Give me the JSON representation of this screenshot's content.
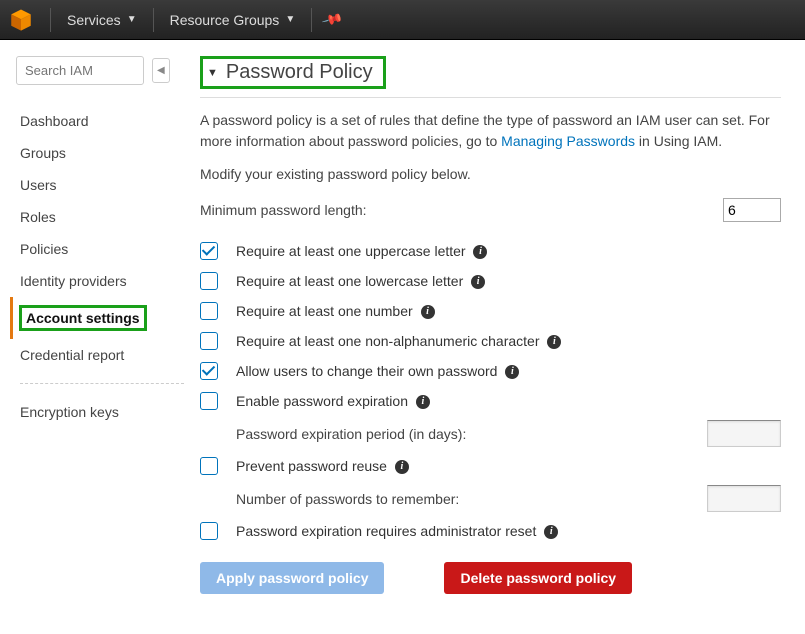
{
  "topnav": {
    "services": "Services",
    "resource_groups": "Resource Groups"
  },
  "sidebar": {
    "search_placeholder": "Search IAM",
    "items": [
      {
        "label": "Dashboard"
      },
      {
        "label": "Groups"
      },
      {
        "label": "Users"
      },
      {
        "label": "Roles"
      },
      {
        "label": "Policies"
      },
      {
        "label": "Identity providers"
      },
      {
        "label": "Account settings"
      },
      {
        "label": "Credential report"
      }
    ],
    "items2": [
      {
        "label": "Encryption keys"
      }
    ]
  },
  "main": {
    "title": "Password Policy",
    "desc_pre": "A password policy is a set of rules that define the type of password an IAM user can set. For more information about password policies, go to ",
    "desc_link": "Managing Passwords",
    "desc_post": " in Using IAM.",
    "subhead": "Modify your existing password policy below.",
    "minlen_label": "Minimum password length:",
    "minlen_value": "6",
    "options": [
      {
        "label": "Require at least one uppercase letter",
        "checked": true,
        "info": true
      },
      {
        "label": "Require at least one lowercase letter",
        "checked": false,
        "info": true
      },
      {
        "label": "Require at least one number",
        "checked": false,
        "info": true
      },
      {
        "label": "Require at least one non-alphanumeric character",
        "checked": false,
        "info": true
      },
      {
        "label": "Allow users to change their own password",
        "checked": true,
        "info": true
      },
      {
        "label": "Enable password expiration",
        "checked": false,
        "info": true
      }
    ],
    "exp_period_label": "Password expiration period (in days):",
    "exp_period_value": "",
    "reuse": {
      "label": "Prevent password reuse",
      "checked": false,
      "info": true
    },
    "remember_label": "Number of passwords to remember:",
    "remember_value": "",
    "admin_reset": {
      "label": "Password expiration requires administrator reset",
      "checked": false,
      "info": true
    },
    "apply_btn": "Apply password policy",
    "delete_btn": "Delete password policy"
  }
}
